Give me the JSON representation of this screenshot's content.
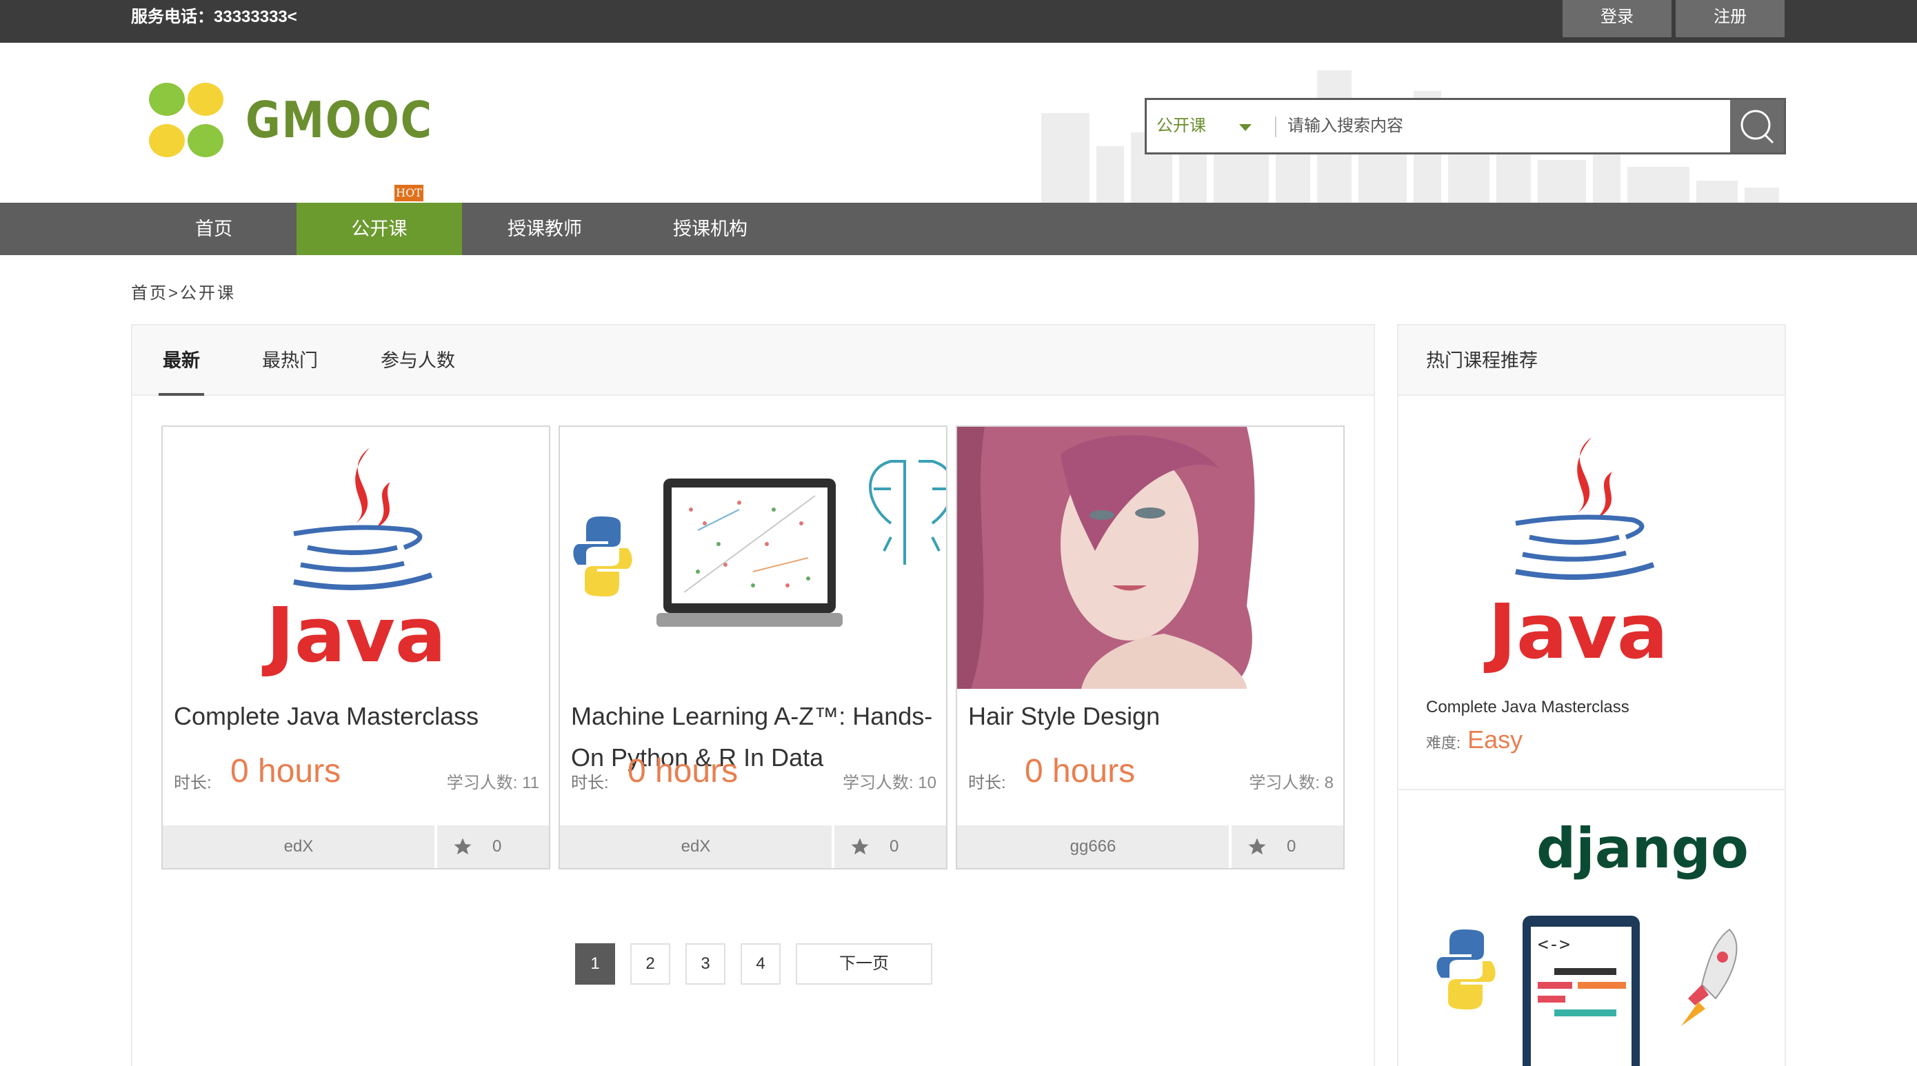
{
  "topbar": {
    "phone": "服务电话：33333333<",
    "login": "登录",
    "register": "注册"
  },
  "header": {
    "brand": "GMOOC",
    "search_category": "公开课",
    "search_placeholder": "请输入搜索内容"
  },
  "nav": {
    "items": [
      "首页",
      "公开课",
      "授课教师",
      "授课机构"
    ],
    "active_index": 1,
    "hot_badge": "HOT"
  },
  "breadcrumb": {
    "home": "首页",
    "sep": ">",
    "current": "公开课"
  },
  "tabs": [
    "最新",
    "最热门",
    "参与人数"
  ],
  "labels": {
    "duration": "时长:",
    "students": "学习人数:",
    "difficulty": "难度:"
  },
  "courses": [
    {
      "title": "Complete Java Masterclass",
      "duration": "0 hours",
      "students": "学习人数: 11",
      "org": "edX",
      "favs": "0",
      "image": "java-logo"
    },
    {
      "title": "Machine Learning A-Z™: Hands-On Python & R In Data",
      "duration": "0 hours",
      "students": "学习人数: 10",
      "org": "edX",
      "favs": "0",
      "image": "ml-python-laptop"
    },
    {
      "title": "Hair Style Design",
      "duration": "0 hours",
      "students": "学习人数: 8",
      "org": "gg666",
      "favs": "0",
      "image": "pink-hair-woman"
    }
  ],
  "pagination": {
    "pages": [
      "1",
      "2",
      "3",
      "4"
    ],
    "active": "1",
    "next": "下一页"
  },
  "sidebar": {
    "title": "热门课程推荐",
    "recommendations": [
      {
        "name": "Complete Java Masterclass",
        "difficulty": "Easy",
        "image": "java-logo"
      },
      {
        "image": "django-logo",
        "django_text": "django"
      }
    ]
  },
  "colors": {
    "topbar": "#3c3c3c",
    "nav": "#5e5e5e",
    "accent_green": "#6b9a2f",
    "orange": "#e97e4f",
    "hot": "#e0701b"
  }
}
